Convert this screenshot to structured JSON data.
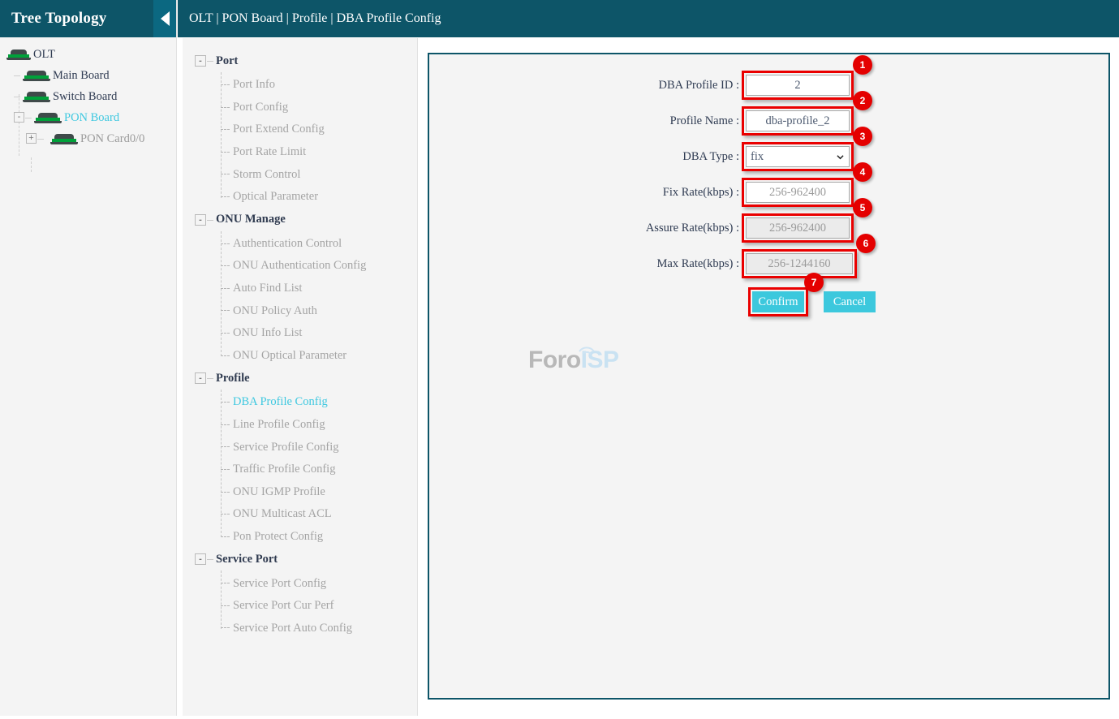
{
  "tree": {
    "title": "Tree Topology",
    "collapse_icon": "caret-left-icon",
    "nodes": [
      {
        "label": "OLT",
        "level": 0,
        "color": "dark",
        "expander": null,
        "icon": "board-icon"
      },
      {
        "label": "Main Board",
        "level": 1,
        "color": "dark",
        "expander": null,
        "icon": "board-icon"
      },
      {
        "label": "Switch Board",
        "level": 1,
        "color": "dark",
        "expander": null,
        "icon": "board-icon"
      },
      {
        "label": "PON Board",
        "level": 1,
        "color": "cyan",
        "expander": "-",
        "icon": "board-icon"
      },
      {
        "label": "PON Card0/0",
        "level": 2,
        "color": "gray",
        "expander": "+",
        "icon": "board-icon"
      }
    ]
  },
  "topbar": {
    "breadcrumb": "OLT | PON Board | Profile | DBA Profile Config"
  },
  "menu": {
    "groups": [
      {
        "title": "Port",
        "expander": "-",
        "items": [
          {
            "label": "Port Info",
            "active": false
          },
          {
            "label": "Port Config",
            "active": false
          },
          {
            "label": "Port Extend Config",
            "active": false
          },
          {
            "label": "Port Rate Limit",
            "active": false
          },
          {
            "label": "Storm Control",
            "active": false
          },
          {
            "label": "Optical Parameter",
            "active": false
          }
        ]
      },
      {
        "title": "ONU Manage",
        "expander": "-",
        "items": [
          {
            "label": "Authentication Control",
            "active": false
          },
          {
            "label": "ONU Authentication Config",
            "active": false
          },
          {
            "label": "Auto Find List",
            "active": false
          },
          {
            "label": "ONU Policy Auth",
            "active": false
          },
          {
            "label": "ONU Info List",
            "active": false
          },
          {
            "label": "ONU Optical Parameter",
            "active": false
          }
        ]
      },
      {
        "title": "Profile",
        "expander": "-",
        "items": [
          {
            "label": "DBA Profile Config",
            "active": true
          },
          {
            "label": "Line Profile Config",
            "active": false
          },
          {
            "label": "Service Profile Config",
            "active": false
          },
          {
            "label": "Traffic Profile Config",
            "active": false
          },
          {
            "label": "ONU IGMP Profile",
            "active": false
          },
          {
            "label": "ONU Multicast ACL",
            "active": false
          },
          {
            "label": "Pon Protect Config",
            "active": false
          }
        ]
      },
      {
        "title": "Service Port",
        "expander": "-",
        "items": [
          {
            "label": "Service Port Config",
            "active": false
          },
          {
            "label": "Service Port Cur Perf",
            "active": false
          },
          {
            "label": "Service Port Auto Config",
            "active": false
          }
        ]
      }
    ]
  },
  "form": {
    "fields": [
      {
        "label": "DBA Profile ID :",
        "value": "2",
        "placeholder": "",
        "type": "text",
        "disabled": false,
        "badge": "1"
      },
      {
        "label": "Profile Name :",
        "value": "dba-profile_2",
        "placeholder": "",
        "type": "text",
        "disabled": false,
        "badge": "2"
      },
      {
        "label": "DBA Type :",
        "value": "fix",
        "placeholder": "",
        "type": "select",
        "disabled": false,
        "badge": "3",
        "options": [
          "fix"
        ]
      },
      {
        "label": "Fix Rate(kbps) :",
        "value": "",
        "placeholder": "256-962400",
        "type": "text",
        "disabled": false,
        "badge": "4"
      },
      {
        "label": "Assure Rate(kbps) :",
        "value": "",
        "placeholder": "256-962400",
        "type": "text",
        "disabled": true,
        "badge": "5"
      },
      {
        "label": "Max Rate(kbps) :",
        "value": "",
        "placeholder": "256-1244160",
        "type": "text",
        "disabled": true,
        "badge": "6"
      }
    ],
    "confirm_label": "Confirm",
    "cancel_label": "Cancel",
    "confirm_badge": "7"
  },
  "watermark": {
    "part1": "Foro",
    "part2": "ISP"
  },
  "colors": {
    "header_teal": "#0d5568",
    "accent_cyan": "#3cc8dd",
    "annotation_red": "#ea0000",
    "badge_red": "#e40000",
    "panel_bg": "#f4f4f4"
  }
}
